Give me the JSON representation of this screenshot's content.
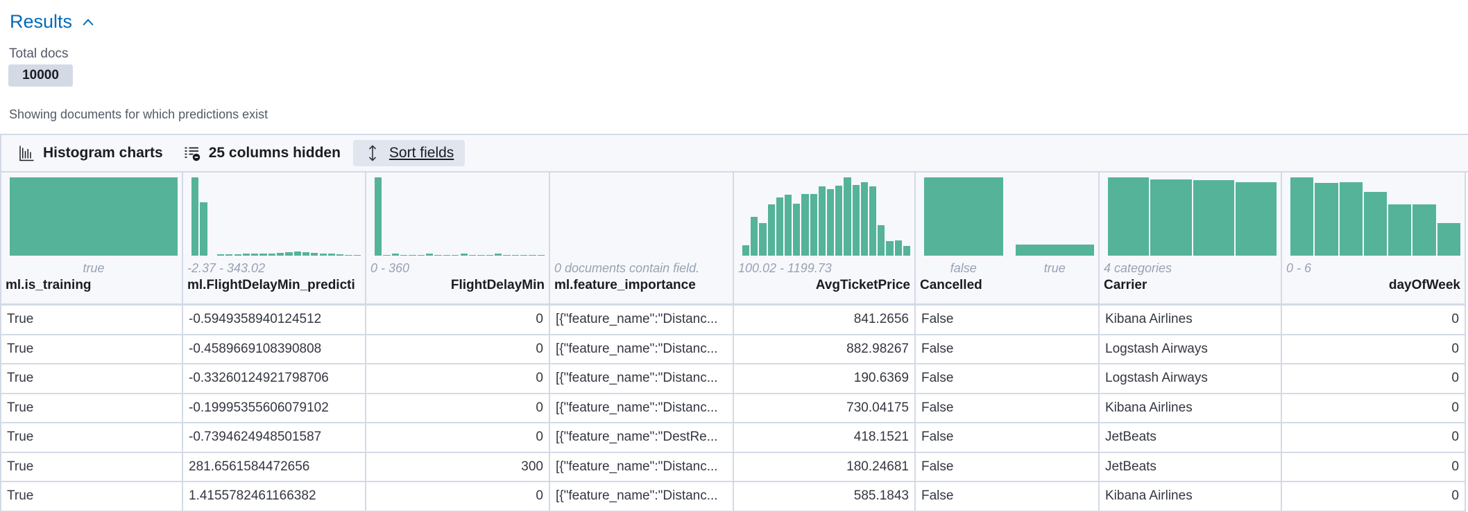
{
  "header": {
    "title": "Results",
    "total_docs_label": "Total docs",
    "total_docs": "10000",
    "subtitle": "Showing documents for which predictions exist"
  },
  "toolbar": {
    "histogram_label": "Histogram charts",
    "columns_hidden_label": "25 columns hidden",
    "sort_label": "Sort fields"
  },
  "colors": {
    "bar": "#54B399",
    "title": "#006BB8"
  },
  "chart_data": [
    {
      "type": "bar",
      "field": "ml.is_training",
      "categories": [
        "true"
      ],
      "values": [
        338
      ]
    },
    {
      "type": "bar",
      "field": "ml.FlightDelayMin_prediction",
      "range": "-2.37 - 343.02",
      "values": [
        338,
        230,
        0,
        5,
        5,
        6,
        8,
        10,
        8,
        10,
        12,
        16,
        18,
        16,
        12,
        8,
        8,
        5,
        4,
        2
      ]
    },
    {
      "type": "bar",
      "field": "FlightDelayMin",
      "range": "0 - 360",
      "values": [
        338,
        4,
        10,
        4,
        4,
        4,
        8,
        4,
        4,
        4,
        10,
        4,
        4,
        4,
        8,
        4,
        4,
        4,
        4,
        4
      ]
    },
    {
      "type": "none",
      "field": "ml.feature_importance",
      "message": "0 documents contain field.",
      "values": []
    },
    {
      "type": "bar",
      "field": "AvgTicketPrice",
      "range": "100.02 - 1199.73",
      "values": [
        45,
        168,
        142,
        220,
        252,
        262,
        224,
        266,
        266,
        300,
        288,
        302,
        338,
        304,
        318,
        298,
        132,
        63,
        67,
        43
      ]
    },
    {
      "type": "bar",
      "field": "Cancelled",
      "categories": [
        "false",
        "true"
      ],
      "values": [
        338,
        48
      ]
    },
    {
      "type": "bar",
      "field": "Carrier",
      "range": "4 categories",
      "values": [
        338,
        330,
        325,
        318
      ]
    },
    {
      "type": "bar",
      "field": "dayOfWeek",
      "range": "0 - 6",
      "values": [
        338,
        315,
        318,
        275,
        221,
        221,
        142
      ]
    }
  ],
  "columns": [
    {
      "name": "ml.is_training",
      "align": "left"
    },
    {
      "name": "ml.FlightDelayMin_predicti",
      "align": "left"
    },
    {
      "name": "FlightDelayMin",
      "align": "right"
    },
    {
      "name": "ml.feature_importance",
      "align": "left"
    },
    {
      "name": "AvgTicketPrice",
      "align": "right"
    },
    {
      "name": "Cancelled",
      "align": "left"
    },
    {
      "name": "Carrier",
      "align": "left"
    },
    {
      "name": "dayOfWeek",
      "align": "right"
    }
  ],
  "rows": [
    [
      "True",
      "-0.5949358940124512",
      "0",
      "[{\"feature_name\":\"Distanc...",
      "841.2656",
      "False",
      "Kibana Airlines",
      "0"
    ],
    [
      "True",
      "-0.4589669108390808",
      "0",
      "[{\"feature_name\":\"Distanc...",
      "882.98267",
      "False",
      "Logstash Airways",
      "0"
    ],
    [
      "True",
      "-0.33260124921798706",
      "0",
      "[{\"feature_name\":\"Distanc...",
      "190.6369",
      "False",
      "Logstash Airways",
      "0"
    ],
    [
      "True",
      "-0.19995355606079102",
      "0",
      "[{\"feature_name\":\"Distanc...",
      "730.04175",
      "False",
      "Kibana Airlines",
      "0"
    ],
    [
      "True",
      "-0.7394624948501587",
      "0",
      "[{\"feature_name\":\"DestRe...",
      "418.1521",
      "False",
      "JetBeats",
      "0"
    ],
    [
      "True",
      "281.6561584472656",
      "300",
      "[{\"feature_name\":\"Distanc...",
      "180.24681",
      "False",
      "JetBeats",
      "0"
    ],
    [
      "True",
      "1.4155782461166382",
      "0",
      "[{\"feature_name\":\"Distanc...",
      "585.1843",
      "False",
      "Kibana Airlines",
      "0"
    ]
  ]
}
